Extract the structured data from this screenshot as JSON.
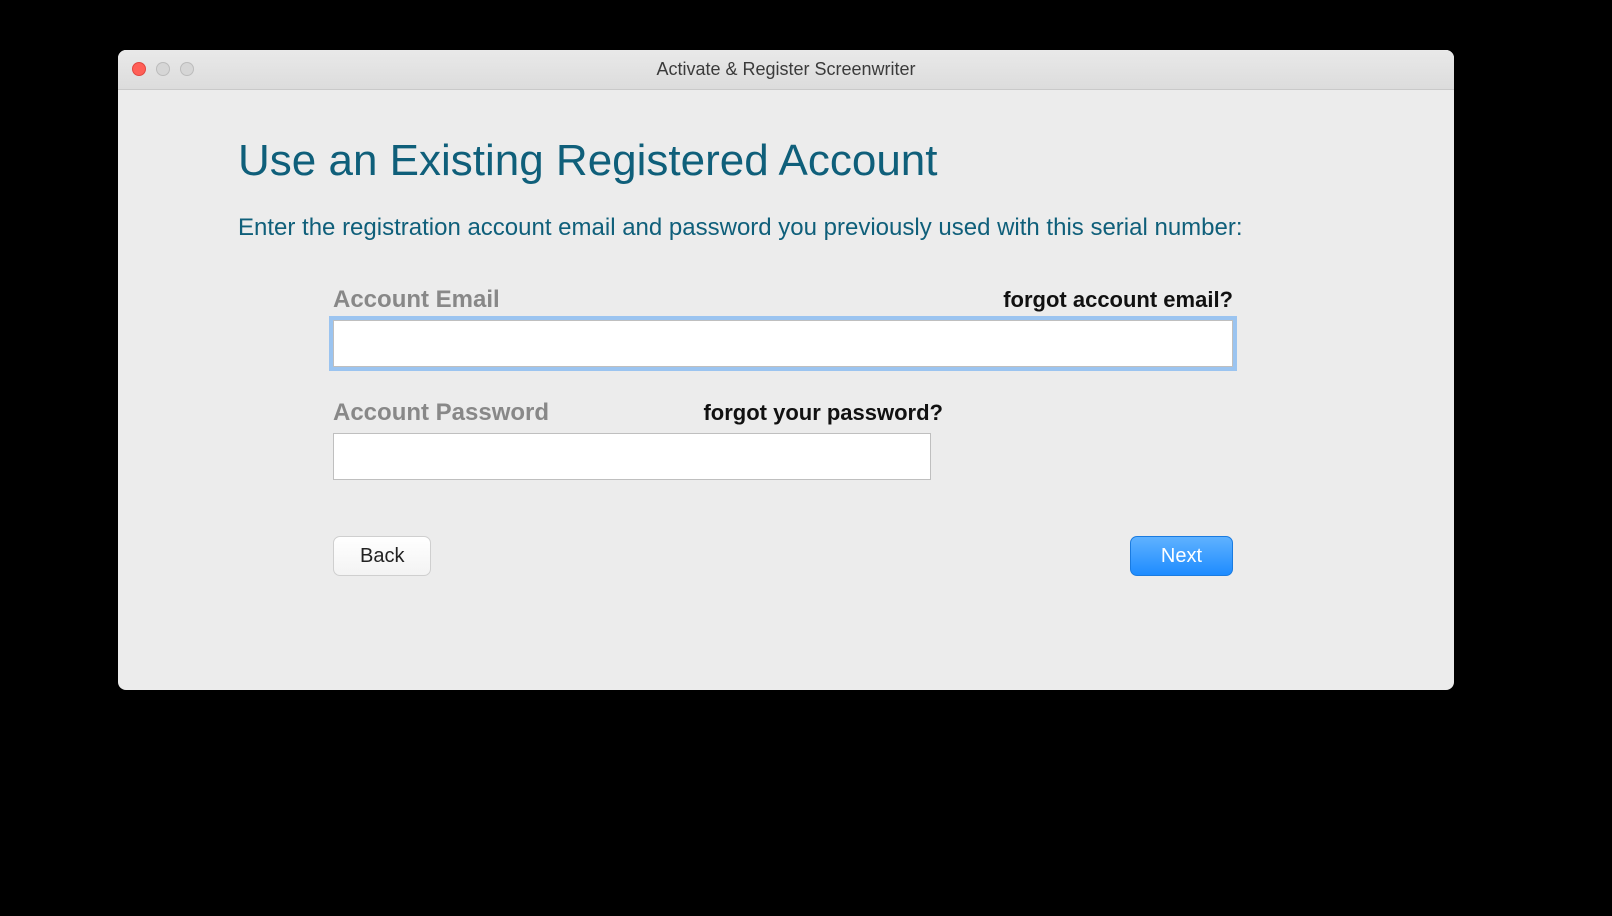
{
  "window": {
    "title": "Activate & Register Screenwriter"
  },
  "content": {
    "heading": "Use an Existing Registered Account",
    "instructions": "Enter the registration account email and password you previously used with this serial number:"
  },
  "form": {
    "email": {
      "label": "Account Email",
      "forgot": "forgot account email?",
      "value": ""
    },
    "password": {
      "label": "Account Password",
      "forgot": "forgot your password?",
      "value": ""
    }
  },
  "buttons": {
    "back": "Back",
    "next": "Next"
  }
}
